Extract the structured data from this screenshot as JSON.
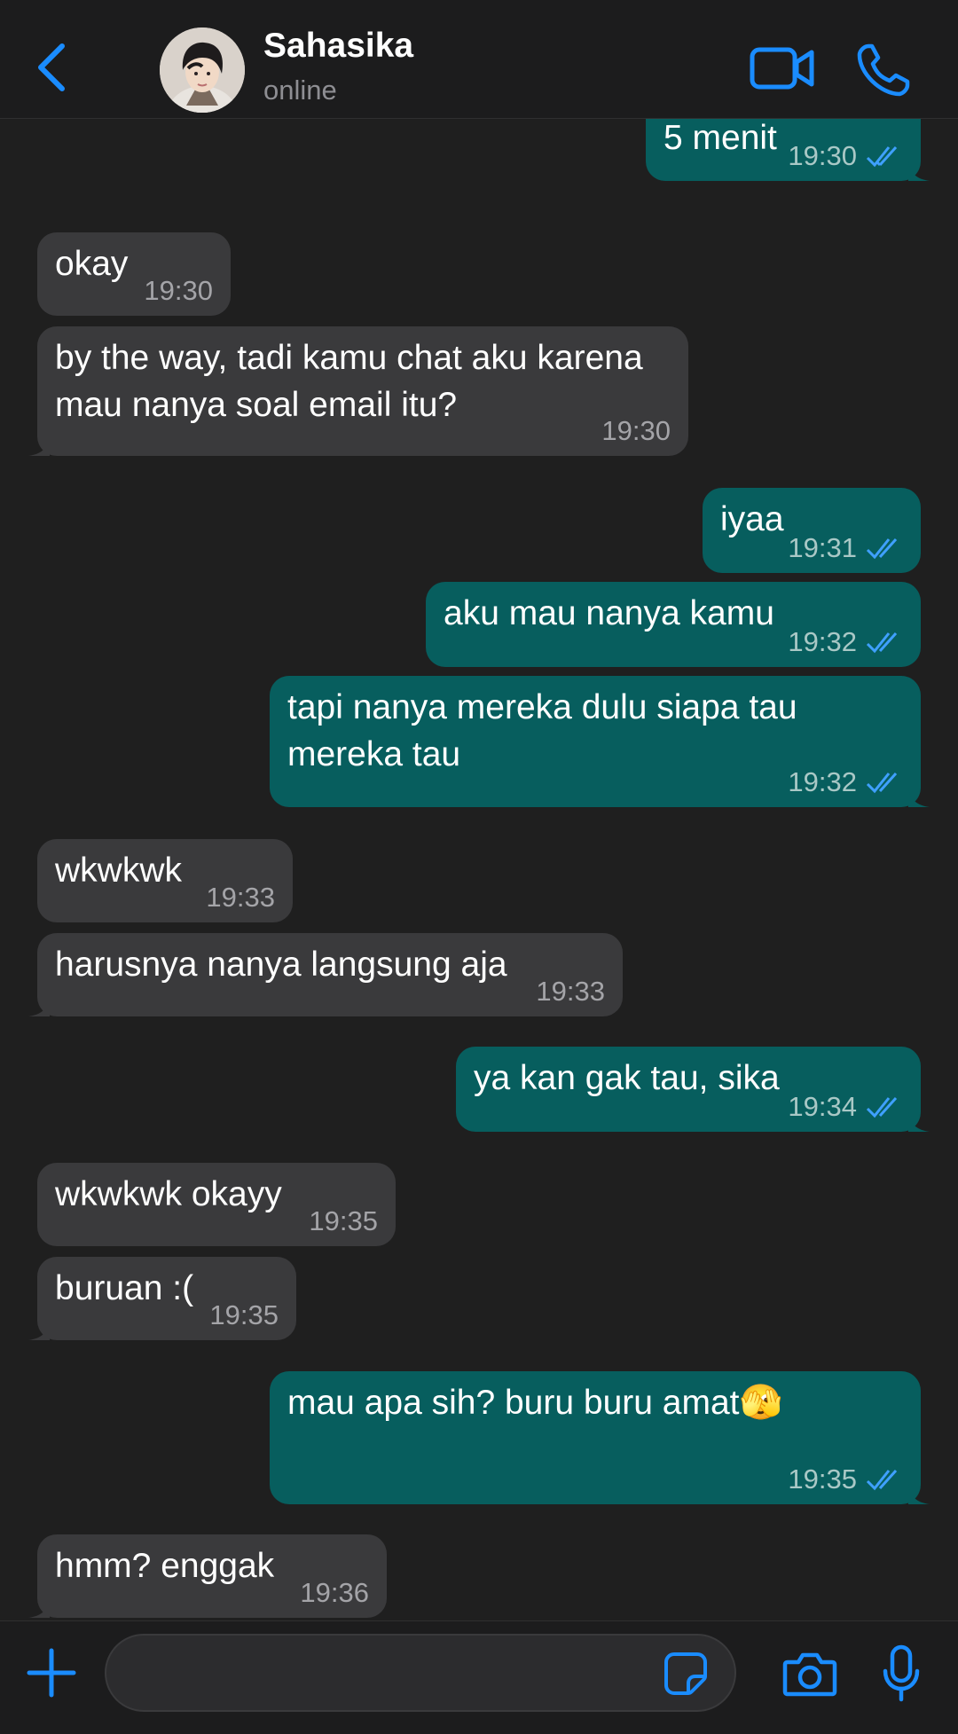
{
  "header": {
    "contact_name": "Sahasika",
    "status": "online",
    "back_icon": "chevron-left-icon",
    "video_icon": "video-camera-icon",
    "call_icon": "phone-icon"
  },
  "messages": [
    {
      "direction": "out",
      "text": "5 menit",
      "time": "19:30",
      "read": true
    },
    {
      "direction": "in",
      "text": "okay",
      "time": "19:30"
    },
    {
      "direction": "in",
      "text": "by the way, tadi kamu chat aku karena mau nanya soal email itu?",
      "time": "19:30"
    },
    {
      "direction": "out",
      "text": "iyaa",
      "time": "19:31",
      "read": true
    },
    {
      "direction": "out",
      "text": "aku mau nanya kamu",
      "time": "19:32",
      "read": true
    },
    {
      "direction": "out",
      "text": "tapi nanya mereka dulu siapa tau mereka tau",
      "time": "19:32",
      "read": true
    },
    {
      "direction": "in",
      "text": "wkwkwk",
      "time": "19:33"
    },
    {
      "direction": "in",
      "text": "harusnya nanya langsung aja",
      "time": "19:33"
    },
    {
      "direction": "out",
      "text": "ya kan gak tau, sika",
      "time": "19:34",
      "read": true
    },
    {
      "direction": "in",
      "text": "wkwkwk okayy",
      "time": "19:35"
    },
    {
      "direction": "in",
      "text": "buruan :(",
      "time": "19:35"
    },
    {
      "direction": "out",
      "text": "mau apa sih? buru buru amat🫣",
      "time": "19:35",
      "read": true
    },
    {
      "direction": "in",
      "text": "hmm? enggak",
      "time": "19:36"
    }
  ],
  "input_bar": {
    "message_value": "",
    "plus_icon": "plus-icon",
    "sticker_icon": "sticker-icon",
    "camera_icon": "camera-icon",
    "mic_icon": "microphone-icon"
  },
  "colors": {
    "accent": "#1a8cff",
    "incoming_bubble": "#3a3a3c",
    "outgoing_bubble": "#075e5e",
    "read_ticks": "#3fa0ff",
    "background": "#1f1f1f"
  }
}
